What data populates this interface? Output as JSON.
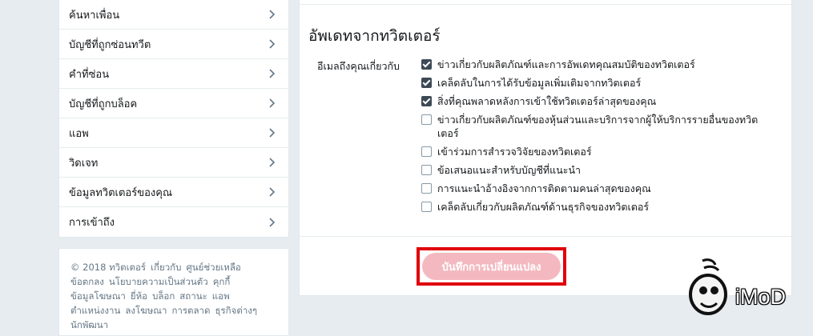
{
  "sidebar": {
    "items": [
      {
        "label": "ค้นหาเพื่อน"
      },
      {
        "label": "บัญชีที่ถูกซ่อนทวีต"
      },
      {
        "label": "คำที่ซ่อน"
      },
      {
        "label": "บัญชีที่ถูกบล็อค"
      },
      {
        "label": "แอพ"
      },
      {
        "label": "วิดเจท"
      },
      {
        "label": "ข้อมูลทวิตเตอร์ของคุณ"
      },
      {
        "label": "การเข้าถึง"
      }
    ],
    "chevron_icon": "chevron-right-icon"
  },
  "footer": {
    "copyright": "© 2018 ทวิตเตอร์",
    "links": [
      "เกี่ยวกับ",
      "ศูนย์ช่วยเหลือ",
      "ข้อตกลง",
      "นโยบายความเป็นส่วนตัว",
      "คุกกี้",
      "ข้อมูลโฆษณา",
      "ยี่ห้อ",
      "บล็อก",
      "สถานะ",
      "แอพ",
      "ตำแหน่งงาน",
      "ลงโฆษณา",
      "การตลาด",
      "ธุรกิจต่างๆ",
      "นักพัฒนา"
    ]
  },
  "main": {
    "section_title": "อัพเดทจากทวิตเตอร์",
    "field_label": "อีเมลถึงคุณเกี่ยวกับ",
    "options": [
      {
        "label": "ข่าวเกี่ยวกับผลิตภัณฑ์และการอัพเดทคุณสมบัติของทวิตเตอร์",
        "checked": true
      },
      {
        "label": "เคล็ดลับในการได้รับข้อมูลเพิ่มเติมจากทวิตเตอร์",
        "checked": true
      },
      {
        "label": "สิ่งที่คุณพลาดหลังการเข้าใช้ทวิตเตอร์ล่าสุดของคุณ",
        "checked": true
      },
      {
        "label": "ข่าวเกี่ยวกับผลิตภัณฑ์ของหุ้นส่วนและบริการจากผู้ให้บริการรายอื่นของทวิตเตอร์",
        "checked": false
      },
      {
        "label": "เข้าร่วมการสำรวจวิจัยของทวิตเตอร์",
        "checked": false
      },
      {
        "label": "ข้อเสนอแนะสำหรับบัญชีที่แนะนำ",
        "checked": false
      },
      {
        "label": "การแนะนำอ้างอิงจากการติดตามคนล่าสุดของคุณ",
        "checked": false
      },
      {
        "label": "เคล็ดลับเกี่ยวกับผลิตภัณฑ์ด้านธุรกิจของทวิตเตอร์",
        "checked": false
      }
    ],
    "save_label": "บันทึกการเปลี่ยนแปลง"
  },
  "watermark": {
    "text": "iMoD",
    "icon": "imod-mascot-icon"
  },
  "colors": {
    "background": "#e6ecf0",
    "panel": "#ffffff",
    "save_button": "#f4b9c0",
    "highlight_frame": "#e0000a",
    "checkbox_checked": "#3d4a55"
  }
}
